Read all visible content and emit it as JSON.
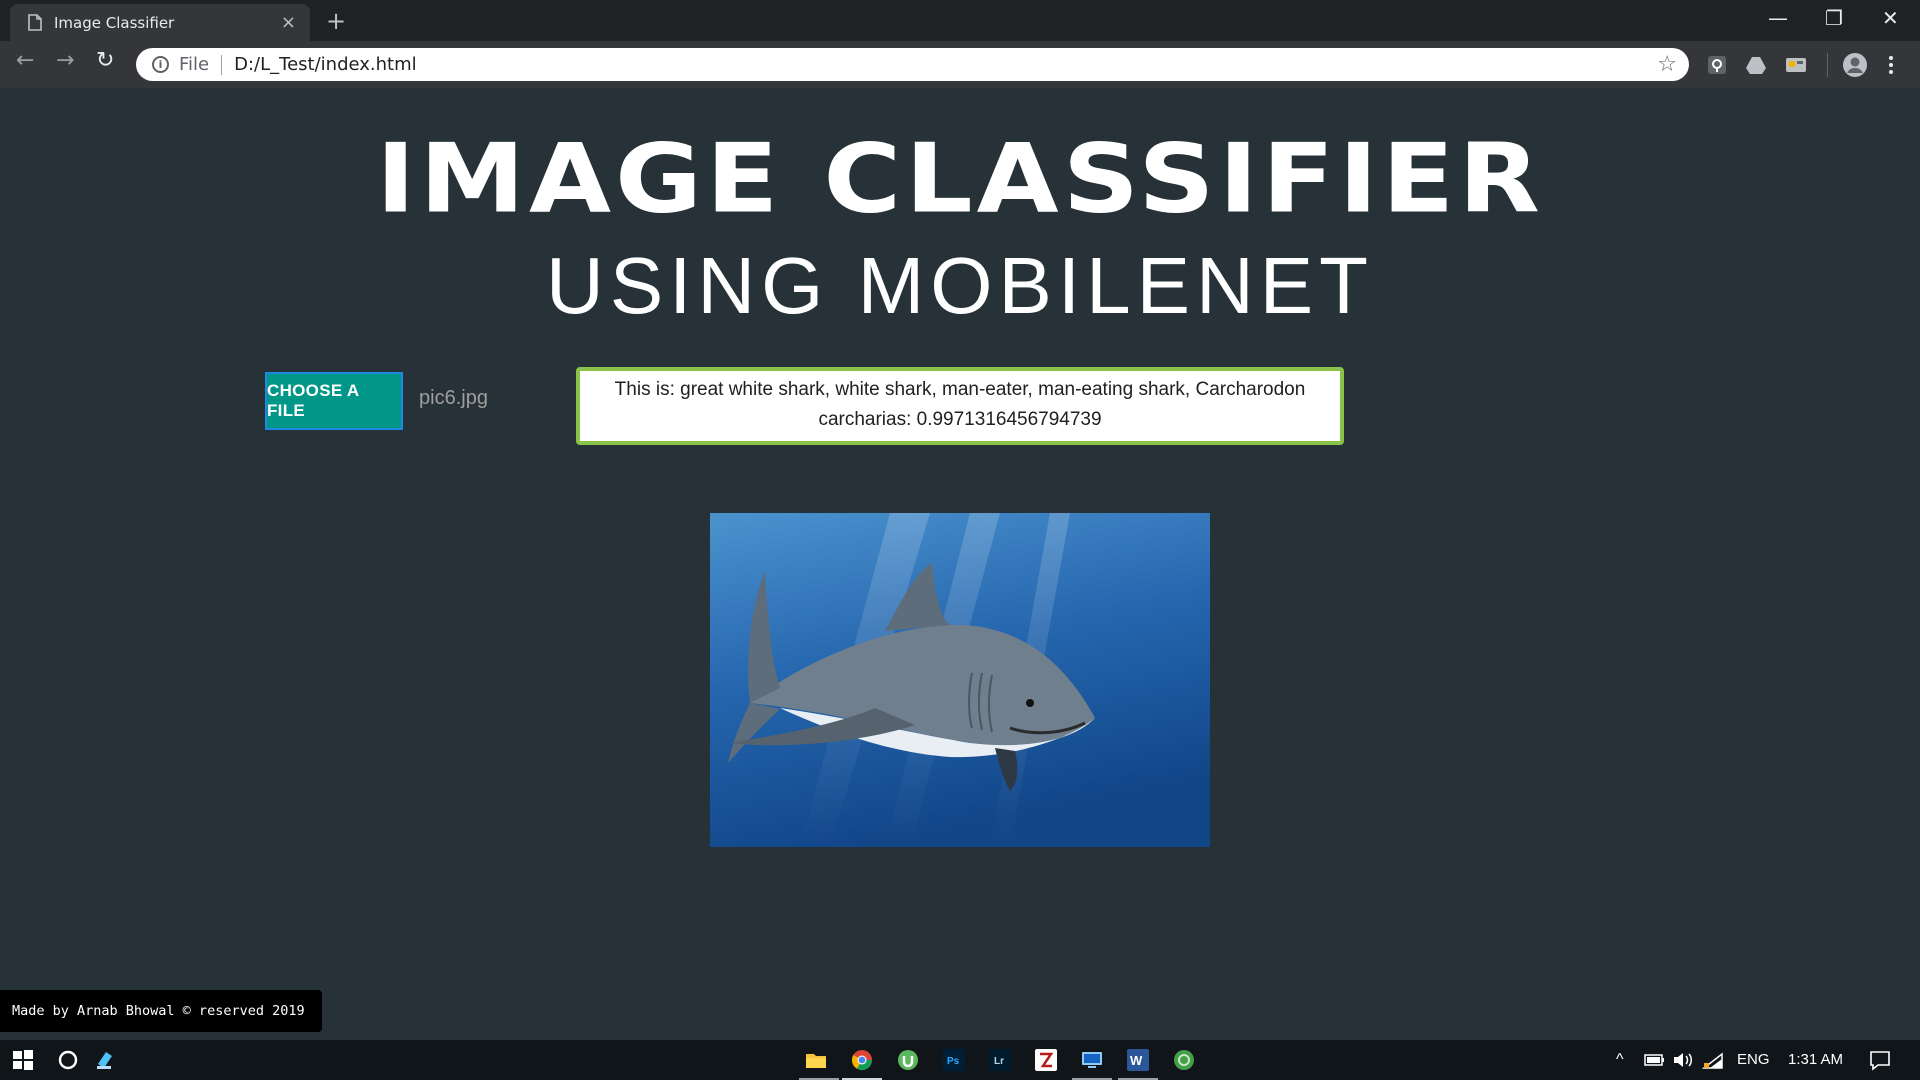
{
  "browser": {
    "tab_title": "Image Classifier",
    "tab_close": "×",
    "new_tab": "+",
    "window_controls": {
      "minimize": "—",
      "restore": "❐",
      "close": "✕"
    },
    "nav": {
      "back": "←",
      "forward": "→",
      "reload": "↻"
    },
    "address": {
      "info": "i",
      "scheme_label": "File",
      "url": "D:/L_Test/index.html",
      "bookmark": "☆"
    }
  },
  "page": {
    "title": "IMAGE CLASSIFIER",
    "subtitle": "USING MOBILENET",
    "choose_button": "CHOOSE A FILE",
    "file_name": "pic6.jpg",
    "result_text": "This is: great white shark, white shark, man-eater, man-eating shark, Carcharodon carcharias: 0.9971316456794739",
    "footer": "Made by Arnab Bhowal © reserved 2019"
  },
  "colors": {
    "page_bg": "#263238",
    "button_bg": "#009688",
    "result_border": "#8bc34a"
  },
  "taskbar": {
    "language": "ENG",
    "time": "1:31 AM"
  }
}
